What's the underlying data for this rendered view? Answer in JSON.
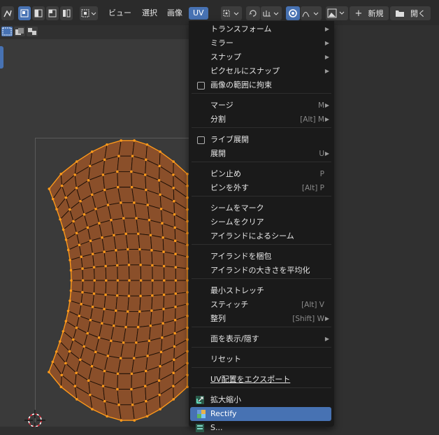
{
  "header": {
    "menus": [
      "ビュー",
      "選択",
      "画像",
      "UV"
    ],
    "new_label": "新規",
    "open_label": "開く"
  },
  "menu": {
    "items": [
      {
        "label": "トランスフォーム",
        "shortcut": "",
        "submenu": true
      },
      {
        "label": "ミラー",
        "shortcut": "",
        "submenu": true
      },
      {
        "label": "スナップ",
        "shortcut": "",
        "submenu": true
      },
      {
        "label": "ピクセルにスナップ",
        "shortcut": "",
        "submenu": true
      },
      {
        "label": "画像の範囲に拘束",
        "checkbox": true
      },
      {
        "label": "マージ",
        "shortcut": "M",
        "submenu": true
      },
      {
        "label": "分割",
        "shortcut": "[Alt] M",
        "submenu": true
      },
      {
        "label": "ライブ展開",
        "checkbox": true
      },
      {
        "label": "展開",
        "shortcut": "U",
        "submenu": true
      },
      {
        "label": "ピン止め",
        "shortcut": "P"
      },
      {
        "label": "ピンを外す",
        "shortcut": "[Alt] P"
      },
      {
        "label": "シームをマーク"
      },
      {
        "label": "シームをクリア"
      },
      {
        "label": "アイランドによるシーム"
      },
      {
        "label": "アイランドを梱包"
      },
      {
        "label": "アイランドの大きさを平均化"
      },
      {
        "label": "最小ストレッチ"
      },
      {
        "label": "スティッチ",
        "shortcut": "[Alt] V"
      },
      {
        "label": "整列",
        "shortcut": "[Shift] W",
        "submenu": true
      },
      {
        "label": "面を表示/隠す",
        "submenu": true
      },
      {
        "label": "リセット"
      },
      {
        "label": "UV配置をエクスポート"
      },
      {
        "label": "拡大縮小",
        "icon": "scale-addon-icon"
      },
      {
        "label": "Rectify",
        "icon": "rectify-addon-icon",
        "highlighted": true
      },
      {
        "label": "S...",
        "icon": "addon-icon"
      }
    ]
  },
  "colors": {
    "accent": "#4772b3",
    "menu_bg": "#1a1a1a",
    "mesh_fill": "#8a4f2a",
    "mesh_edge": "#ff9a1a"
  }
}
